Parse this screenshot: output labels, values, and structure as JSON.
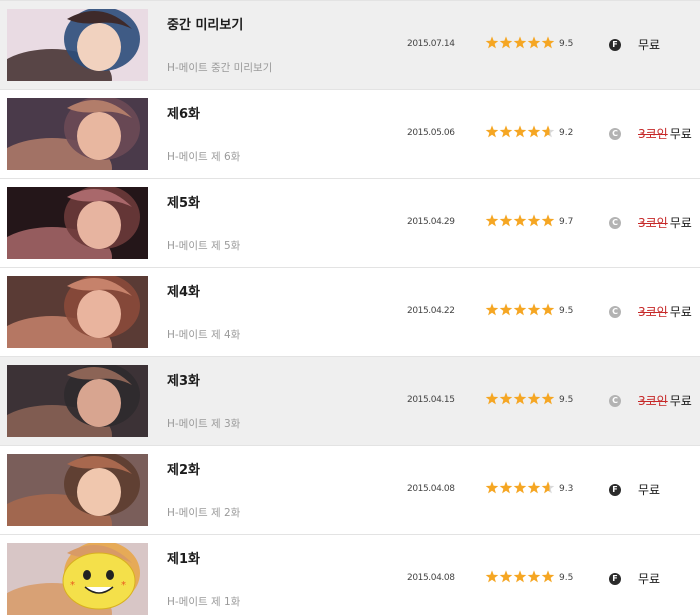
{
  "colors": {
    "star": "#f5a623",
    "highlight_row": "#efefef",
    "strike": "#c62828",
    "free_badge": "#2b2b2b",
    "coin_badge": "#b3b3b3"
  },
  "episodes": [
    {
      "title": "중간 미리보기",
      "subtitle": "H-메이트 중간 미리보기",
      "date": "2015.07.14",
      "rating": 9.5,
      "rating_text": "9.5",
      "stars": 5,
      "badge_icon": "free-badge-icon",
      "badge_letter": "F",
      "old_price": "",
      "price": "무료",
      "highlighted": true
    },
    {
      "title": "제6화",
      "subtitle": "H-메이트 제 6화",
      "date": "2015.05.06",
      "rating": 9.2,
      "rating_text": "9.2",
      "stars": 4.6,
      "badge_icon": "coin-badge-icon",
      "badge_letter": "C",
      "old_price": "3코인",
      "price": "무료",
      "highlighted": false
    },
    {
      "title": "제5화",
      "subtitle": "H-메이트 제 5화",
      "date": "2015.04.29",
      "rating": 9.7,
      "rating_text": "9.7",
      "stars": 5,
      "badge_icon": "coin-badge-icon",
      "badge_letter": "C",
      "old_price": "3코인",
      "price": "무료",
      "highlighted": false
    },
    {
      "title": "제4화",
      "subtitle": "H-메이트 제 4화",
      "date": "2015.04.22",
      "rating": 9.5,
      "rating_text": "9.5",
      "stars": 5,
      "badge_icon": "coin-badge-icon",
      "badge_letter": "C",
      "old_price": "3코인",
      "price": "무료",
      "highlighted": false
    },
    {
      "title": "제3화",
      "subtitle": "H-메이트 제 3화",
      "date": "2015.04.15",
      "rating": 9.5,
      "rating_text": "9.5",
      "stars": 5,
      "badge_icon": "coin-badge-icon",
      "badge_letter": "C",
      "old_price": "3코인",
      "price": "무료",
      "highlighted": true
    },
    {
      "title": "제2화",
      "subtitle": "H-메이트 제 2화",
      "date": "2015.04.08",
      "rating": 9.3,
      "rating_text": "9.3",
      "stars": 4.6,
      "badge_icon": "free-badge-icon",
      "badge_letter": "F",
      "old_price": "",
      "price": "무료",
      "highlighted": false
    },
    {
      "title": "제1화",
      "subtitle": "H-메이트 제 1화",
      "date": "2015.04.08",
      "rating": 9.5,
      "rating_text": "9.5",
      "stars": 5,
      "badge_icon": "free-badge-icon",
      "badge_letter": "F",
      "old_price": "",
      "price": "무료",
      "highlighted": false
    }
  ]
}
